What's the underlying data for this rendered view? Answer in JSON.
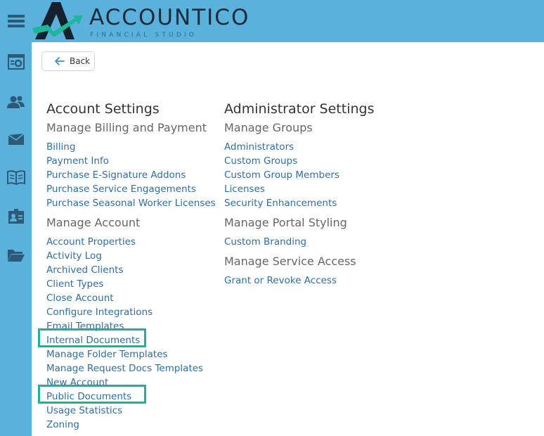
{
  "sidebar": {
    "icons": [
      {
        "name": "menu-icon"
      },
      {
        "name": "dashboard-settings-icon"
      },
      {
        "name": "users-icon"
      },
      {
        "name": "mail-icon"
      },
      {
        "name": "book-icon"
      },
      {
        "name": "contact-card-icon"
      },
      {
        "name": "folder-icon"
      }
    ]
  },
  "header": {
    "brand": "ACCOUNTICO",
    "tagline": "FINANCIAL STUDIO",
    "accent_color": "#5ab1dc"
  },
  "back_button": {
    "label": "Back"
  },
  "account_settings": {
    "title": "Account Settings",
    "groups": [
      {
        "title": "Manage Billing and Payment",
        "links": [
          "Billing",
          "Payment Info",
          "Purchase E-Signature Addons",
          "Purchase Service Engagements",
          "Purchase Seasonal Worker Licenses"
        ]
      },
      {
        "title": "Manage Account",
        "links": [
          "Account Properties",
          "Activity Log",
          "Archived Clients",
          "Client Types",
          "Close Account",
          "Configure Integrations",
          "Email Templates",
          "Internal Documents",
          "Manage Folder Templates",
          "Manage Request Docs Templates",
          "New Account",
          "Public Documents",
          "Usage Statistics",
          "Zoning"
        ]
      }
    ]
  },
  "administrator_settings": {
    "title": "Administrator Settings",
    "groups": [
      {
        "title": "Manage Groups",
        "links": [
          "Administrators",
          "Custom Groups",
          "Custom Group Members",
          "Licenses",
          "Security Enhancements"
        ]
      },
      {
        "title": "Manage Portal Styling",
        "links": [
          "Custom Branding"
        ]
      },
      {
        "title": "Manage Service Access",
        "links": [
          "Grant or Revoke Access"
        ]
      }
    ]
  }
}
